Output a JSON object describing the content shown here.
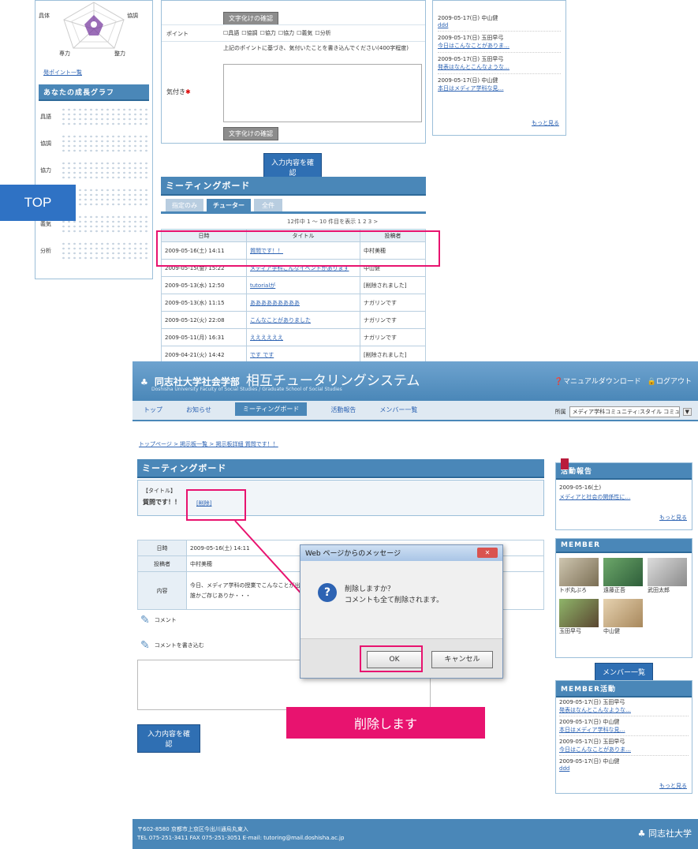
{
  "top_badge": "TOP",
  "delete_badge": "削除します",
  "upper": {
    "radar_labels": [
      "具体",
      "協調",
      "専力",
      "整力"
    ],
    "side_link": "発ポイント一覧",
    "my_graph_title": "あなたの成長グラフ",
    "graph_rows": [
      "具語",
      "協調",
      "協力",
      "",
      "義気",
      "分析"
    ],
    "form_btn_top": "文字化けの確認",
    "point_label": "ポイント",
    "point_options": [
      "具語",
      "協調",
      "協力",
      "協力",
      "義気",
      "分析"
    ],
    "comment_hint": "上記のポイントに基づき、気付いたことを書き込んでください(400字程度)",
    "comment_label": "気付き",
    "form_btn_bottom": "文字化けの確認",
    "confirm_btn": "入力内容を確認",
    "board_title": "ミーティングボード",
    "tabs": [
      "指定のみ",
      "チューター",
      "全件"
    ],
    "pager": "12件中 1 ～ 10 件目を表示 1 2 3 >",
    "table_headers": [
      "日時",
      "タイトル",
      "投稿者"
    ],
    "rows": [
      {
        "date": "2009-05-16(土) 14:11",
        "title": "質問です！！",
        "author": "中村美穂"
      },
      {
        "date": "2009-05-15(金) 15:22",
        "title": "メディア学科こんなイベントがあります",
        "author": "中山健"
      },
      {
        "date": "2009-05-13(水) 12:50",
        "title": "tutorialが",
        "author": "[削除されました]"
      },
      {
        "date": "2009-05-13(水) 11:15",
        "title": "あああああああああ",
        "author": "ナガリンです"
      },
      {
        "date": "2009-05-12(火) 22:08",
        "title": "こんなことがありました",
        "author": "ナガリンです"
      },
      {
        "date": "2009-05-11(月) 16:31",
        "title": "ええええええ",
        "author": "ナガリンです"
      },
      {
        "date": "2009-04-21(火) 14:42",
        "title": "です です",
        "author": "[削除されました]"
      }
    ],
    "right_entries": [
      {
        "date": "2009-05-17(日) 中山健",
        "text": "ddd"
      },
      {
        "date": "2009-05-17(日) 玉田早弓",
        "text": "今日はこんなことがありま…"
      },
      {
        "date": "2009-05-17(日) 玉田早弓",
        "text": "発表はなんとこんなような…"
      },
      {
        "date": "2009-05-17(日) 中山健",
        "text": "本日はメディア学科な見…"
      }
    ],
    "right_more": "もっと見る"
  },
  "header": {
    "logo_text": "同志社大学社会学部",
    "title": "相互チュータリングシステム",
    "subtitle": "Doshisha University Faculty of Social Studies / Graduate School of Social Studies",
    "manual": "マニュアルダウンロード",
    "logout": "ログアウト",
    "nav": [
      "トップ",
      "お知らせ",
      "ミーティングボード",
      "活動報告",
      "メンバー一覧"
    ],
    "group_label": "所属",
    "group_value": "メディア学科コミュニティ:スタイル コミュニティ"
  },
  "breadcrumb": "トップページ > 掲示板一覧 > 掲示板詳細 質問です！！",
  "board": {
    "title": "ミーティングボード",
    "title_label": "【タイトル】",
    "post_title": "質問です！！",
    "delete_link": "[削除]",
    "rows": [
      {
        "label": "日時",
        "value": "2009-05-16(土) 14:11"
      },
      {
        "label": "投稿者",
        "value": "中村美穂"
      },
      {
        "label": "内容",
        "value": "今日、メディア学科の授業でこんなことが出てきました。\n誰かご存じありか・・・"
      }
    ],
    "comment": "コメント",
    "write_comment": "コメントを書き込む",
    "confirm_btn": "入力内容を確認"
  },
  "dialog": {
    "title": "Web ページからのメッセージ",
    "line1": "削除しますか？",
    "line2": "コメントも全て削除されます。",
    "ok": "OK",
    "cancel": "キャンセル"
  },
  "sidebar": {
    "report_title": "活動報告",
    "report_date": "2009-05-16(土)",
    "report_text": "メディアと社会の関係性に…",
    "more": "もっと見る",
    "member_title": "MEMBER",
    "members": [
      "トボ丸ぶろ",
      "遠藤正吾",
      "武田太郎",
      "玉田早弓",
      "中山健"
    ],
    "member_btn": "メンバー一覧",
    "activity_title": "MEMBER活動",
    "activities": [
      {
        "date": "2009-05-17(日) 玉田早弓",
        "text": "発表はなんとこんなような…"
      },
      {
        "date": "2009-05-17(日) 中山健",
        "text": "本日はメディア学科な見…"
      },
      {
        "date": "2009-05-17(日) 玉田早弓",
        "text": "今日はこんなことがありま…"
      },
      {
        "date": "2009-05-17(日) 中山健",
        "text": "ddd"
      }
    ],
    "more2": "もっと見る"
  },
  "footer": {
    "line1": "〒602-8580 京都市上京区今出川通烏丸東入",
    "line2": "TEL 075-251-3411 FAX 075-251-3051 E-mail: tutoring@mail.doshisha.ac.jp",
    "logo": "同志社大学"
  },
  "colors": {
    "accent": "#4a87b8",
    "highlight_pink": "#e8136f",
    "top_badge": "#2f72c4"
  }
}
